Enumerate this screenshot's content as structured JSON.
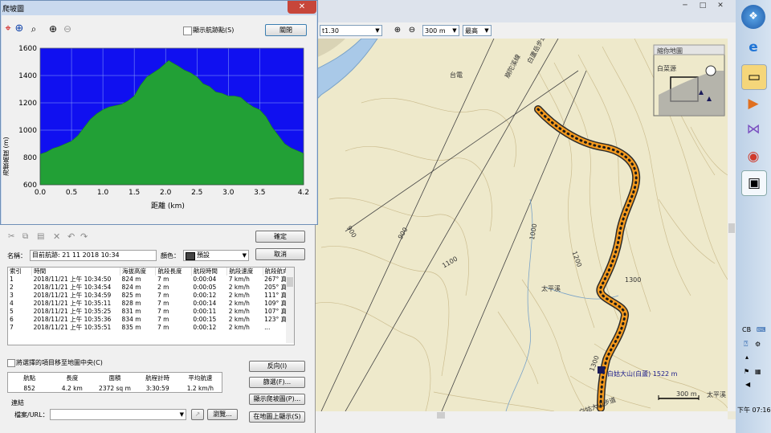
{
  "profile_window": {
    "title": "爬坡圖",
    "close_glyph": "✕",
    "show_points_label": "顯示航跡點(S)",
    "close_button": "關閉",
    "icons": [
      "crosshair-icon",
      "target-icon",
      "lasso-icon",
      "zoom-in-icon",
      "zoom-out-icon"
    ]
  },
  "chart_data": {
    "type": "area",
    "title": "",
    "xlabel": "距離  (km)",
    "ylabel": "海拔高度 (m)",
    "xlim": [
      0.0,
      4.2
    ],
    "ylim": [
      600,
      1600
    ],
    "x_ticks": [
      "0.0",
      "0.5",
      "1.0",
      "1.5",
      "2.0",
      "2.5",
      "3.0",
      "3.5",
      "4.2"
    ],
    "y_ticks": [
      "1600",
      "1400",
      "1200",
      "1000",
      "800",
      "600"
    ],
    "grid": true,
    "fill_color": "#22A036",
    "background_color": "#1010F0",
    "x": [
      0.0,
      0.1,
      0.2,
      0.3,
      0.4,
      0.5,
      0.6,
      0.7,
      0.8,
      0.9,
      1.0,
      1.1,
      1.2,
      1.3,
      1.4,
      1.5,
      1.6,
      1.7,
      1.8,
      1.9,
      2.0,
      2.05,
      2.1,
      2.2,
      2.3,
      2.4,
      2.5,
      2.6,
      2.7,
      2.8,
      2.9,
      3.0,
      3.1,
      3.2,
      3.3,
      3.4,
      3.5,
      3.6,
      3.7,
      3.8,
      3.9,
      4.0,
      4.1,
      4.2
    ],
    "y": [
      824,
      840,
      865,
      880,
      900,
      920,
      960,
      1020,
      1080,
      1120,
      1150,
      1170,
      1180,
      1190,
      1215,
      1250,
      1330,
      1390,
      1420,
      1450,
      1490,
      1510,
      1495,
      1470,
      1440,
      1420,
      1390,
      1340,
      1320,
      1280,
      1270,
      1250,
      1250,
      1240,
      1200,
      1170,
      1150,
      1100,
      1020,
      960,
      900,
      870,
      850,
      830
    ]
  },
  "track_dialog": {
    "toolbar_icons": [
      "cut-icon",
      "copy-icon",
      "paste-icon",
      "delete-icon",
      "undo-icon",
      "redo-icon"
    ],
    "ok_button": "確定",
    "cancel_button": "取消",
    "name_label": "名稱：",
    "name_value": "目前航跡: 21 11 2018 10:34",
    "color_label": "顏色：",
    "color_value": "預設",
    "table_headers": [
      "索引",
      "時間",
      "海拔高度",
      "航段長度",
      "航段時間",
      "航段速度",
      "航段航向"
    ],
    "rows": [
      [
        "1",
        "2018/11/21 上午 10:34:50",
        "824 m",
        "7 m",
        "0:00:04",
        "7 km/h",
        "267° 真"
      ],
      [
        "2",
        "2018/11/21 上午 10:34:54",
        "824 m",
        "2 m",
        "0:00:05",
        "2 km/h",
        "205° 真"
      ],
      [
        "3",
        "2018/11/21 上午 10:34:59",
        "825 m",
        "7 m",
        "0:00:12",
        "2 km/h",
        "111° 真"
      ],
      [
        "4",
        "2018/11/21 上午 10:35:11",
        "828 m",
        "7 m",
        "0:00:14",
        "2 km/h",
        "109° 真"
      ],
      [
        "5",
        "2018/11/21 上午 10:35:25",
        "831 m",
        "7 m",
        "0:00:11",
        "2 km/h",
        "107° 真"
      ],
      [
        "6",
        "2018/11/21 上午 10:35:36",
        "834 m",
        "7 m",
        "0:00:15",
        "2 km/h",
        "123° 真"
      ],
      [
        "7",
        "2018/11/21 上午 10:35:51",
        "835 m",
        "7 m",
        "0:00:12",
        "2 km/h",
        "..."
      ]
    ],
    "center_checkbox_label": "將選擇的項目移至地圖中央(C)",
    "reverse_button": "反向(I)",
    "filter_button": "篩選(F)...",
    "profile_button": "顯示爬坡圖(P)...",
    "show_on_map_button": "在地圖上顯示(S)",
    "stats_headers": [
      "航點",
      "長度",
      "面積",
      "航程計時",
      "平均航速"
    ],
    "stats_values": [
      "852",
      "4.2 km",
      "2372 sq m",
      "3:30:59",
      "1.2 km/h"
    ],
    "link_section_label": "連結",
    "file_url_label": "檔案/URL：",
    "browse_button": "瀏覽..."
  },
  "app_window": {
    "min_glyph": "─",
    "max_glyph": "□",
    "close_glyph": "✕",
    "map_combo_value": "t1.30",
    "zoom_combo_value": "300 m",
    "detail_combo_value": "最高"
  },
  "map": {
    "labels": {
      "road_label": "白蘆岳步道",
      "ridge_label": "崩陀溪線",
      "station_label": "台電",
      "mid_label": "太平溪",
      "summit_label": "白姑大山(白蘆) 1522 m",
      "bottom_right_label": "太平溪",
      "bottom_label": "白姑大山步道"
    },
    "contours": [
      "900",
      "900",
      "1000",
      "1100",
      "1200",
      "1300",
      "1300"
    ],
    "scale_label": "300 m",
    "overview_title": "縮你地圖",
    "overview_label": "白菜源"
  },
  "taskbar": {
    "apps": [
      "start-orb-icon",
      "ie-icon",
      "explorer-icon",
      "media-icon",
      "vs-icon",
      "chrome-icon",
      "monitor-icon"
    ],
    "lang": "CB",
    "time": "下午 07:16"
  }
}
